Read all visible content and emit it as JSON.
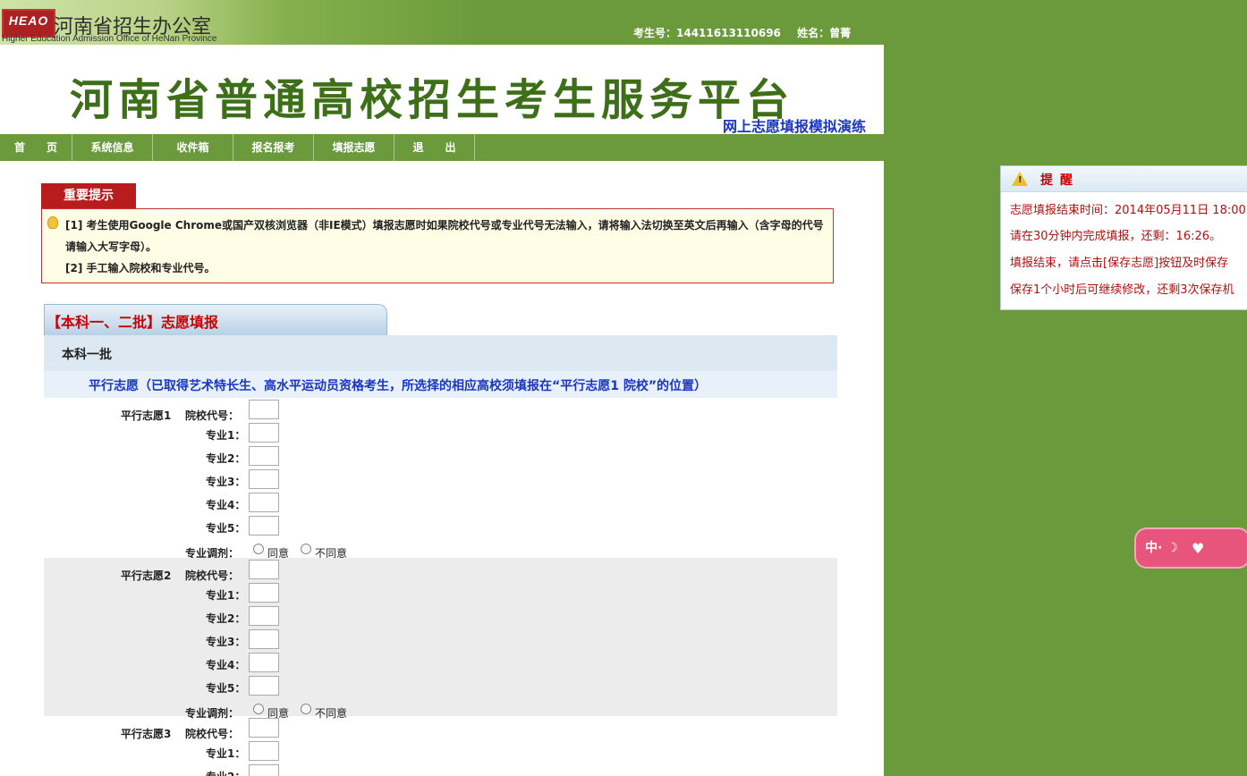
{
  "header": {
    "logo_badge": "HEAO",
    "logo_cn": "河南省招生办公室",
    "logo_en": "Higher Education Admission Office of HeNan Province",
    "exam_no_label": "考生号：14411613110696",
    "name_label": "姓名：曾菁"
  },
  "banner": {
    "title": "河南省普通高校招生考生服务平台",
    "subtitle": "网上志愿填报模拟演练"
  },
  "nav": [
    "首　　页",
    "系统信息",
    "收件箱",
    "报名报考",
    "填报志愿",
    "退　　出"
  ],
  "notice": {
    "tab": "重要提示",
    "line1": "[1] 考生使用Google Chrome或国产双核浏览器（非IE模式）填报志愿时如果院校代号或专业代号无法输入，请将输入法切换至英文后再输入（含字母的代号请输入大写字母）。",
    "line2": "[2] 手工输入院校和专业代号。"
  },
  "form": {
    "section_title": "【本科一、二批】志愿填报",
    "batch": "本科一批",
    "parallel_desc": "平行志愿（已取得艺术特长生、高水平运动员资格考生，所选择的相应高校须填报在“平行志愿1 院校”的位置）",
    "choice_labels": [
      "平行志愿1",
      "平行志愿2",
      "平行志愿3"
    ],
    "school_code_label": "院校代号：",
    "major_labels": [
      "专业1：",
      "专业2：",
      "专业3：",
      "专业4：",
      "专业5："
    ],
    "adjust_label": "专业调剂：",
    "agree": "同意",
    "disagree": "不同意"
  },
  "reminder": {
    "title": "提醒",
    "lines": [
      "志愿填报结束时间：2014年05月11日 18:00",
      "请在30分钟内完成填报，还剩：16:26。",
      "填报结束，请点击[保存志愿]按钮及时保存",
      "保存1个小时后可继续修改，还剩3次保存机"
    ]
  },
  "ime": {
    "label": "中·",
    "moon": "☽"
  }
}
